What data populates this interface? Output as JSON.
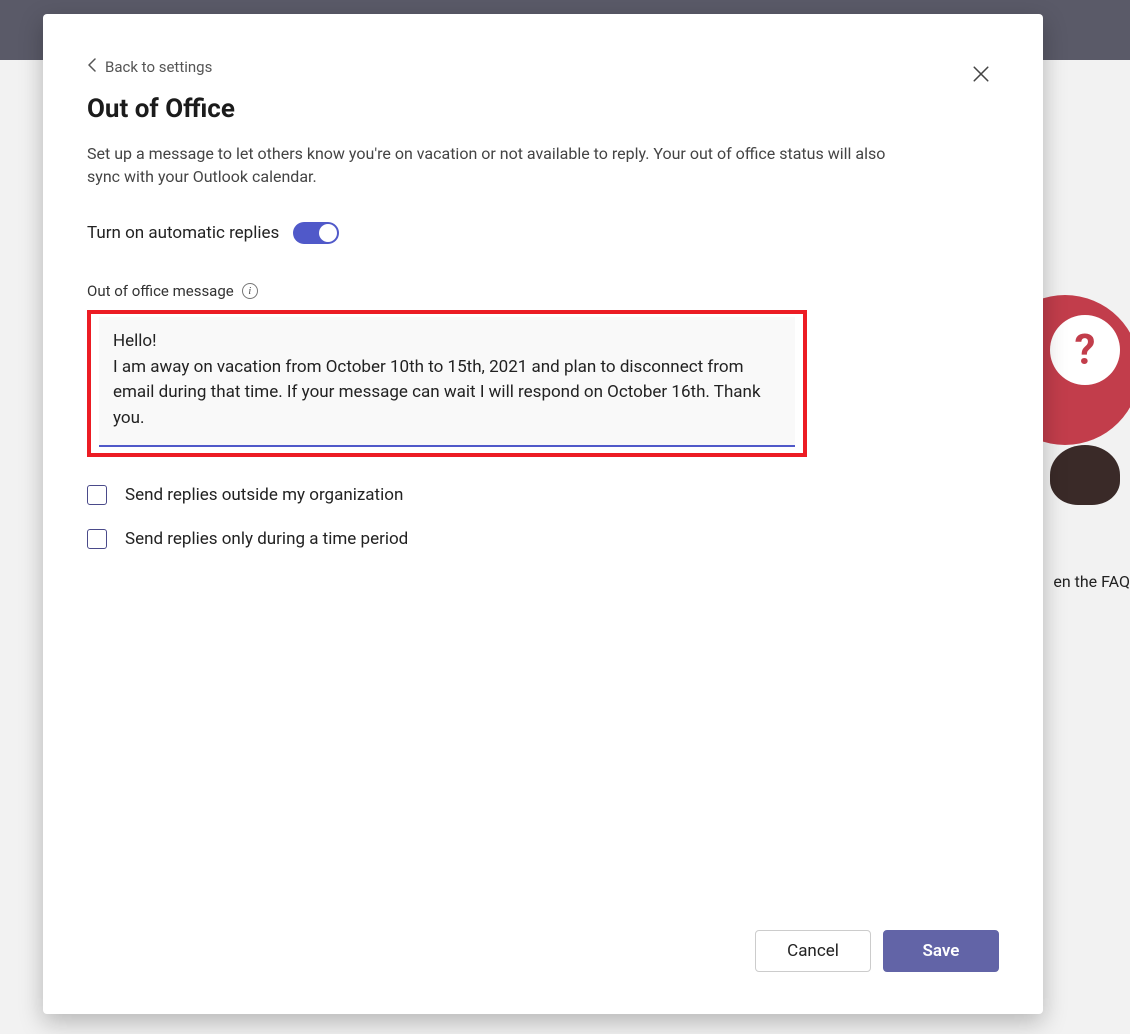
{
  "background": {
    "faq_partial_text": "en the FAQ"
  },
  "dialog": {
    "back_label": "Back to settings",
    "title": "Out of Office",
    "description": "Set up a message to let others know you're on vacation or not available to reply. Your out of office status will also sync with your Outlook calendar.",
    "toggle_label": "Turn on automatic replies",
    "toggle_on": true,
    "message_label": "Out of office message",
    "message_text": "Hello!\nI am away on vacation from October 10th to 15th, 2021 and plan to disconnect from email during that time. If your message can wait I will respond on October 16th. Thank you.",
    "checkbox_outside_label": "Send replies outside my organization",
    "checkbox_outside_checked": false,
    "checkbox_time_label": "Send replies only during a time period",
    "checkbox_time_checked": false,
    "cancel_label": "Cancel",
    "save_label": "Save"
  }
}
